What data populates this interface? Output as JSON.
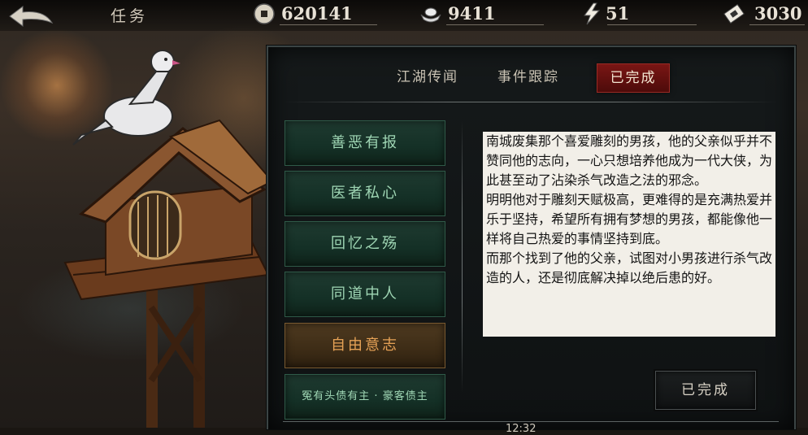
{
  "header": {
    "title": "任务",
    "resources": [
      {
        "icon": "copper-coin-icon",
        "value": "620141"
      },
      {
        "icon": "silver-ingot-icon",
        "value": "9411"
      },
      {
        "icon": "lightning-icon",
        "value": "51"
      },
      {
        "icon": "ticket-icon",
        "value": "3030"
      }
    ]
  },
  "tabs": [
    {
      "label": "江湖传闻",
      "active": false
    },
    {
      "label": "事件跟踪",
      "active": false
    },
    {
      "label": "已完成",
      "active": true
    }
  ],
  "quests": [
    {
      "label": "善恶有报",
      "active": false
    },
    {
      "label": "医者私心",
      "active": false
    },
    {
      "label": "回忆之殇",
      "active": false
    },
    {
      "label": "同道中人",
      "active": false
    },
    {
      "label": "自由意志",
      "active": true
    },
    {
      "label": "冤有头债有主 · 豪客债主",
      "active": false
    }
  ],
  "description": "南城废集那个喜爱雕刻的男孩，他的父亲似乎并不赞同他的志向，一心只想培养他成为一代大侠，为此甚至动了沾染杀气改造之法的邪念。\n明明他对于雕刻天赋极高，更难得的是充满热爱并乐于坚持，希望所有拥有梦想的男孩，都能像他一样将自己热爱的事情坚持到底。\n而那个找到了他的父亲，试图对小男孩进行杀气改造的人，还是彻底解决掉以绝后患的好。",
  "complete_button": "已完成",
  "page_number": "12:32",
  "colors": {
    "accent_red": "#7a1614",
    "quest_green": "#9fd6b4",
    "quest_active_orange": "#e6a256"
  }
}
